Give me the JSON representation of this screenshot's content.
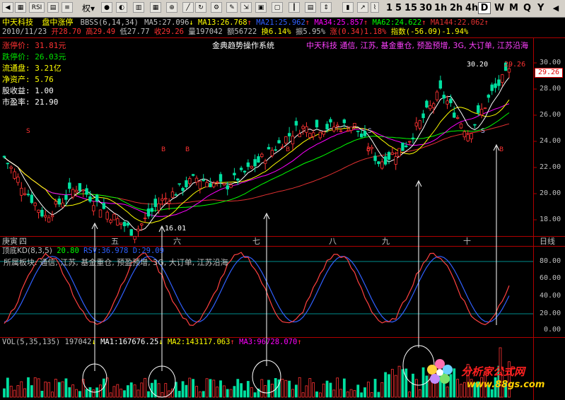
{
  "toolbar": {
    "rsi_label": "RSI",
    "weight_label": "权",
    "periods": [
      "1",
      "5",
      "15",
      "30",
      "1h",
      "2h",
      "4h",
      "D",
      "W",
      "M",
      "Q",
      "Y"
    ],
    "active_period": "D"
  },
  "header": {
    "stock_name": "中天科技",
    "status": "盘中涨停",
    "indicator": "BBSS(6,14,34)",
    "ma5": "MA5:27.096",
    "ma13": "MA13:26.768",
    "ma21": "MA21:25.962",
    "ma34": "MA34:25.857",
    "ma62": "MA62:24.622",
    "ma144": "MA144:22.062"
  },
  "quote": {
    "date": "2010/11/23",
    "open": "开28.70",
    "high": "高29.49",
    "low": "低27.77",
    "close": "收29.26",
    "volume": "量197042",
    "amount": "额56722",
    "turnover": "换6.14%",
    "amplitude": "振5.95%",
    "change": "涨(0.34)1.18%",
    "index": "指数(-56.09)-1.94%"
  },
  "info": [
    {
      "label": "涨停价:",
      "value": "31.81元"
    },
    {
      "label": "跌停价:",
      "value": "26.03元"
    },
    {
      "label": "流通盘:",
      "value": "3.21亿"
    },
    {
      "label": "净资产:",
      "value": "5.76"
    },
    {
      "label": "股收益:",
      "value": "1.00"
    },
    {
      "label": "市盈率:",
      "value": "21.90"
    }
  ],
  "chart_title": "金典趋势操作系统",
  "concept_line": "中天科技 通信, 江苏, 基金重仓, 预盈预增, 3G, 大订单, 江苏沿海",
  "price_axis": [
    "30.00",
    "28.00",
    "26.00",
    "24.00",
    "22.00",
    "20.00",
    "18.00"
  ],
  "current_price": "29.26",
  "high_label": "30.20",
  "high_price_label": "29.26",
  "low_label": "16.01",
  "time_axis": {
    "year_label": "庚寅",
    "months": [
      "四",
      "五",
      "六",
      "七",
      "八",
      "九",
      "十"
    ],
    "period_label": "日线"
  },
  "kd": {
    "title": "顶底KD(8,3,5)",
    "v1": "20.80",
    "v2": "RSV:36.978",
    "v3": "D:29.09",
    "note": "所属板块: 通信, 江苏, 基金重仓, 预盈预增, 3G, 大订单, 江苏沿海",
    "axis": [
      "80.00",
      "60.00",
      "40.00",
      "20.00",
      "0.00"
    ]
  },
  "vol": {
    "title": "VOL(5,35,135)",
    "value": "197042",
    "ma1": "MA1:167676.25",
    "ma2": "MA2:143117.063",
    "ma3": "MA3:96728.070"
  },
  "watermark": {
    "title": "分析家公式网",
    "url": "www.88gs.com"
  },
  "colors": {
    "up": "#ff3232",
    "down": "#00e0a0",
    "ma5": "#ffffff",
    "ma13": "#ffff00",
    "ma21": "#ff00ff",
    "ma34": "#00ff00",
    "ma62": "#e03030",
    "kd_k": "#ff4040",
    "kd_d": "#3060ff"
  }
}
